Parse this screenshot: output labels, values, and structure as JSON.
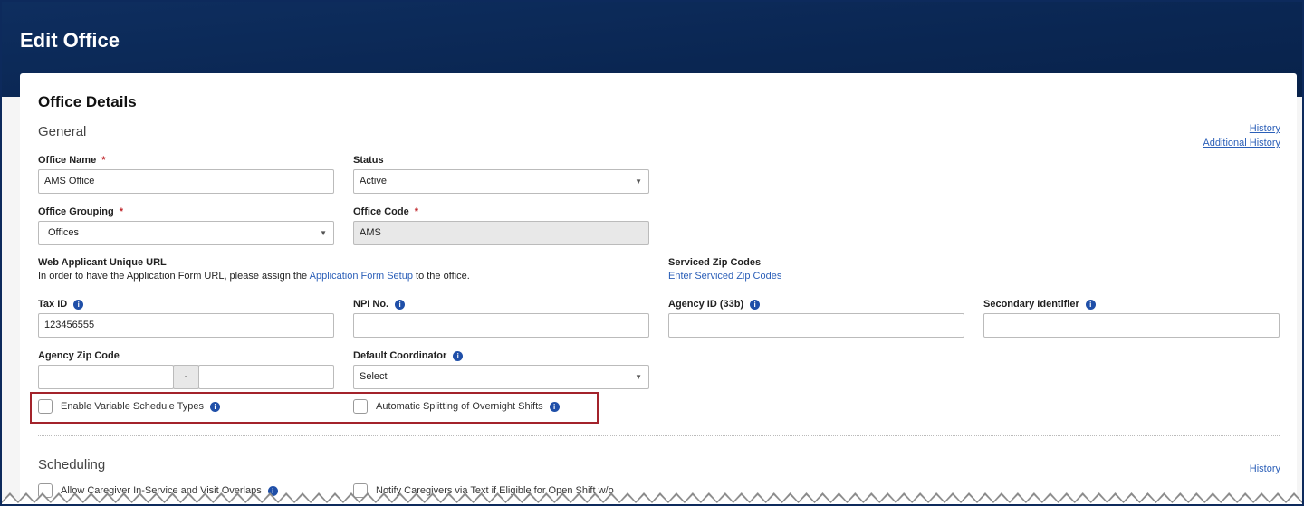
{
  "header": {
    "title": "Edit Office"
  },
  "card": {
    "title": "Office Details",
    "section_general": "General",
    "history_link": "History",
    "additional_history_link": "Additional History"
  },
  "fields": {
    "office_name": {
      "label": "Office Name",
      "required": "*",
      "value": "AMS Office"
    },
    "status": {
      "label": "Status",
      "value": "Active"
    },
    "office_grouping": {
      "label": "Office Grouping",
      "required": "*",
      "value": "Offices"
    },
    "office_code": {
      "label": "Office Code",
      "required": "*",
      "value": "AMS"
    },
    "web_applicant": {
      "label": "Web Applicant Unique URL",
      "text_before": "In order to have the Application Form URL, please assign the ",
      "link": "Application Form Setup",
      "text_after": " to the office."
    },
    "serviced_zip": {
      "label": "Serviced Zip Codes",
      "link": "Enter Serviced Zip Codes"
    },
    "tax_id": {
      "label": "Tax ID",
      "value": "123456555"
    },
    "npi": {
      "label": "NPI No.",
      "value": ""
    },
    "agency_id": {
      "label": "Agency ID (33b)",
      "value": ""
    },
    "secondary_identifier": {
      "label": "Secondary Identifier",
      "value": ""
    },
    "agency_zip": {
      "label": "Agency Zip Code",
      "separator": "-",
      "value1": "",
      "value2": ""
    },
    "default_coordinator": {
      "label": "Default Coordinator",
      "value": "Select"
    }
  },
  "checkboxes": {
    "enable_variable": {
      "label": "Enable Variable Schedule Types",
      "checked": false
    },
    "auto_split": {
      "label": "Automatic Splitting of Overnight Shifts",
      "checked": false
    }
  },
  "scheduling": {
    "title": "Scheduling",
    "history_link": "History",
    "allow_overlap": {
      "label": "Allow Caregiver In-Service and Visit Overlaps",
      "checked": false
    },
    "notify_text": {
      "label": "Notify Caregivers via Text if Eligible for Open Shift w/o",
      "checked": false
    }
  },
  "icons": {
    "info": "info-icon",
    "caret": "chevron-down-icon"
  },
  "colors": {
    "header": "#0a2652",
    "highlight_box": "#a3232b",
    "link": "#2b5fb8",
    "required": "#c0282d"
  }
}
